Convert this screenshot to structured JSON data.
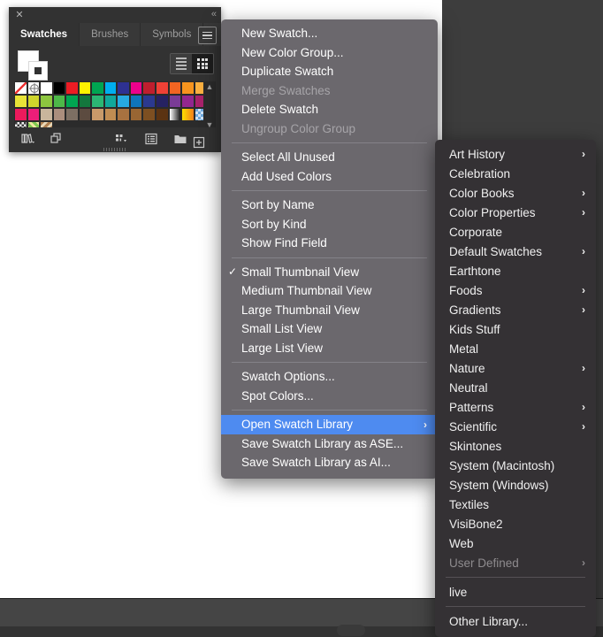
{
  "panel": {
    "close_icon": "✕",
    "collapse_icon": "«",
    "tabs": [
      {
        "label": "Swatches",
        "active": true
      },
      {
        "label": "Brushes",
        "active": false
      },
      {
        "label": "Symbols",
        "active": false
      }
    ],
    "menu_icon": "hamburger-icon",
    "fill_label": "Fill",
    "stroke_label": "Stroke",
    "view_list_icon": "list-view-icon",
    "view_grid_icon": "grid-view-icon",
    "scroll_up_icon": "▲",
    "scroll_down_icon": "▼",
    "footer_icons": [
      {
        "name": "swatch-libraries-menu-icon"
      },
      {
        "name": "show-swatch-kinds-menu-icon"
      },
      {
        "name": "swatch-options-icon"
      },
      {
        "name": "new-color-group-icon"
      },
      {
        "name": "new-swatch-icon"
      },
      {
        "name": "delete-swatch-icon"
      }
    ],
    "swatches": [
      "none",
      "registration",
      "#ffffff",
      "#000000",
      "#ec1c24",
      "#fff200",
      "#00a551",
      "#00aeef",
      "#2e3192",
      "#ec008c",
      "#bf1e2e",
      "#ef4136",
      "#f26522",
      "#f7941e",
      "#fbb040",
      "#e8e337",
      "#cfd52c",
      "#8dc63f",
      "#4db848",
      "#00a651",
      "#13773d",
      "#2bb673",
      "#10a89b",
      "#27aae1",
      "#0f75bc",
      "#2b3990",
      "#262262",
      "#7a3b96",
      "#92278f",
      "#a8226b",
      "#ec1a5c",
      "#ed1e79",
      "#c9b59c",
      "#ab8e7d",
      "#7d6f63",
      "#5c4b40",
      "#c89a6a",
      "#c08c52",
      "#a87240",
      "#996633",
      "#7d4f21",
      "#5b3312",
      "gradient-white-black",
      "gradient-yellow-orange",
      "gradient-blue-checker",
      "pattern-dots",
      "pattern-green",
      "pattern-brown"
    ]
  },
  "context_menu": {
    "groups": [
      {
        "items": [
          {
            "label": "New Swatch...",
            "disabled": false,
            "checked": false,
            "submenu": false,
            "highlight": false
          },
          {
            "label": "New Color Group...",
            "disabled": false,
            "checked": false,
            "submenu": false,
            "highlight": false
          },
          {
            "label": "Duplicate Swatch",
            "disabled": false,
            "checked": false,
            "submenu": false,
            "highlight": false
          },
          {
            "label": "Merge Swatches",
            "disabled": true,
            "checked": false,
            "submenu": false,
            "highlight": false
          },
          {
            "label": "Delete Swatch",
            "disabled": false,
            "checked": false,
            "submenu": false,
            "highlight": false
          },
          {
            "label": "Ungroup Color Group",
            "disabled": true,
            "checked": false,
            "submenu": false,
            "highlight": false
          }
        ]
      },
      {
        "items": [
          {
            "label": "Select All Unused",
            "disabled": false,
            "checked": false,
            "submenu": false,
            "highlight": false
          },
          {
            "label": "Add Used Colors",
            "disabled": false,
            "checked": false,
            "submenu": false,
            "highlight": false
          }
        ]
      },
      {
        "items": [
          {
            "label": "Sort by Name",
            "disabled": false,
            "checked": false,
            "submenu": false,
            "highlight": false
          },
          {
            "label": "Sort by Kind",
            "disabled": false,
            "checked": false,
            "submenu": false,
            "highlight": false
          },
          {
            "label": "Show Find Field",
            "disabled": false,
            "checked": false,
            "submenu": false,
            "highlight": false
          }
        ]
      },
      {
        "items": [
          {
            "label": "Small Thumbnail View",
            "disabled": false,
            "checked": true,
            "submenu": false,
            "highlight": false
          },
          {
            "label": "Medium Thumbnail View",
            "disabled": false,
            "checked": false,
            "submenu": false,
            "highlight": false
          },
          {
            "label": "Large Thumbnail View",
            "disabled": false,
            "checked": false,
            "submenu": false,
            "highlight": false
          },
          {
            "label": "Small List View",
            "disabled": false,
            "checked": false,
            "submenu": false,
            "highlight": false
          },
          {
            "label": "Large List View",
            "disabled": false,
            "checked": false,
            "submenu": false,
            "highlight": false
          }
        ]
      },
      {
        "items": [
          {
            "label": "Swatch Options...",
            "disabled": false,
            "checked": false,
            "submenu": false,
            "highlight": false
          },
          {
            "label": "Spot Colors...",
            "disabled": false,
            "checked": false,
            "submenu": false,
            "highlight": false
          }
        ]
      },
      {
        "items": [
          {
            "label": "Open Swatch Library",
            "disabled": false,
            "checked": false,
            "submenu": true,
            "highlight": true
          },
          {
            "label": "Save Swatch Library as ASE...",
            "disabled": false,
            "checked": false,
            "submenu": false,
            "highlight": false
          },
          {
            "label": "Save Swatch Library as AI...",
            "disabled": false,
            "checked": false,
            "submenu": false,
            "highlight": false
          }
        ]
      }
    ],
    "check_glyph": "✓",
    "submenu_glyph": "›",
    "highlight_color": "#4e8bf0",
    "background_color": "#6b686d"
  },
  "submenu": {
    "background_color": "#343134",
    "groups": [
      {
        "items": [
          {
            "label": "Art History",
            "submenu": true,
            "disabled": false
          },
          {
            "label": "Celebration",
            "submenu": false,
            "disabled": false
          },
          {
            "label": "Color Books",
            "submenu": true,
            "disabled": false
          },
          {
            "label": "Color Properties",
            "submenu": true,
            "disabled": false
          },
          {
            "label": "Corporate",
            "submenu": false,
            "disabled": false
          },
          {
            "label": "Default Swatches",
            "submenu": true,
            "disabled": false
          },
          {
            "label": "Earthtone",
            "submenu": false,
            "disabled": false
          },
          {
            "label": "Foods",
            "submenu": true,
            "disabled": false
          },
          {
            "label": "Gradients",
            "submenu": true,
            "disabled": false
          },
          {
            "label": "Kids Stuff",
            "submenu": false,
            "disabled": false
          },
          {
            "label": "Metal",
            "submenu": false,
            "disabled": false
          },
          {
            "label": "Nature",
            "submenu": true,
            "disabled": false
          },
          {
            "label": "Neutral",
            "submenu": false,
            "disabled": false
          },
          {
            "label": "Patterns",
            "submenu": true,
            "disabled": false
          },
          {
            "label": "Scientific",
            "submenu": true,
            "disabled": false
          },
          {
            "label": "Skintones",
            "submenu": false,
            "disabled": false
          },
          {
            "label": "System (Macintosh)",
            "submenu": false,
            "disabled": false
          },
          {
            "label": "System (Windows)",
            "submenu": false,
            "disabled": false
          },
          {
            "label": "Textiles",
            "submenu": false,
            "disabled": false
          },
          {
            "label": "VisiBone2",
            "submenu": false,
            "disabled": false
          },
          {
            "label": "Web",
            "submenu": false,
            "disabled": false
          },
          {
            "label": "User Defined",
            "submenu": true,
            "disabled": true
          }
        ]
      },
      {
        "items": [
          {
            "label": "live",
            "submenu": false,
            "disabled": false
          }
        ]
      },
      {
        "items": [
          {
            "label": "Other Library...",
            "submenu": false,
            "disabled": false
          }
        ]
      }
    ],
    "submenu_glyph": "›"
  }
}
